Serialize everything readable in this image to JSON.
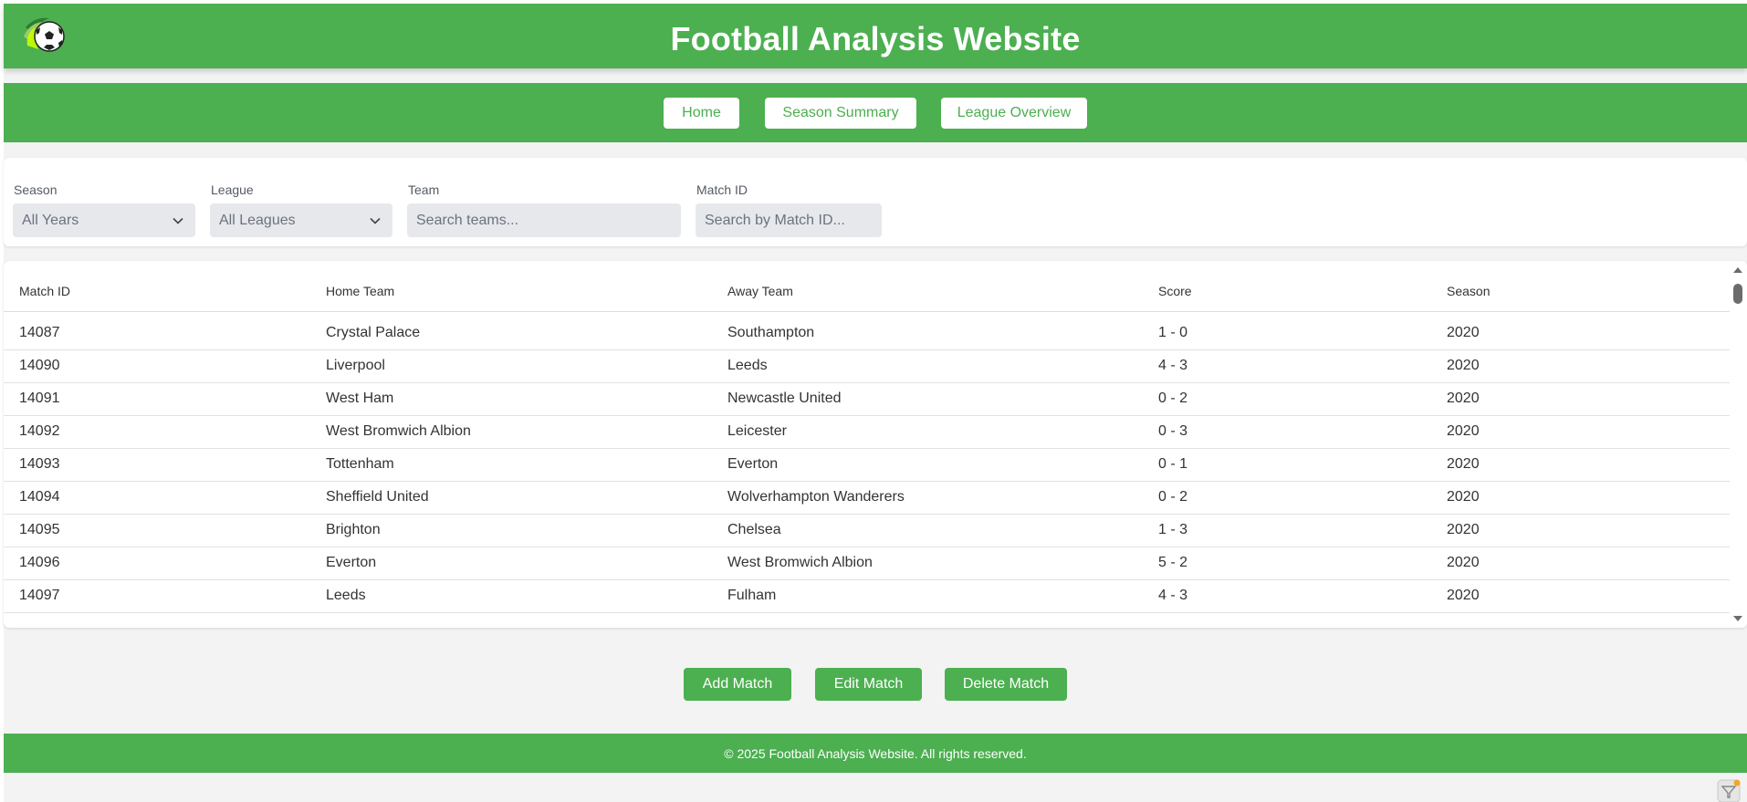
{
  "header": {
    "title": "Football Analysis Website",
    "logo_icon": "soccer-ball-icon"
  },
  "nav": {
    "items": [
      {
        "label": "Home"
      },
      {
        "label": "Season Summary"
      },
      {
        "label": "League Overview"
      }
    ]
  },
  "filters": {
    "season": {
      "label": "Season",
      "value": "All Years"
    },
    "league": {
      "label": "League",
      "value": "All Leagues"
    },
    "team": {
      "label": "Team",
      "placeholder": "Search teams..."
    },
    "match_id": {
      "label": "Match ID",
      "placeholder": "Search by Match ID..."
    }
  },
  "table": {
    "columns": [
      "Match ID",
      "Home Team",
      "Away Team",
      "Score",
      "Season"
    ],
    "rows": [
      [
        "14087",
        "Crystal Palace",
        "Southampton",
        "1 - 0",
        "2020"
      ],
      [
        "14090",
        "Liverpool",
        "Leeds",
        "4 - 3",
        "2020"
      ],
      [
        "14091",
        "West Ham",
        "Newcastle United",
        "0 - 2",
        "2020"
      ],
      [
        "14092",
        "West Bromwich Albion",
        "Leicester",
        "0 - 3",
        "2020"
      ],
      [
        "14093",
        "Tottenham",
        "Everton",
        "0 - 1",
        "2020"
      ],
      [
        "14094",
        "Sheffield United",
        "Wolverhampton Wanderers",
        "0 - 2",
        "2020"
      ],
      [
        "14095",
        "Brighton",
        "Chelsea",
        "1 - 3",
        "2020"
      ],
      [
        "14096",
        "Everton",
        "West Bromwich Albion",
        "5 - 2",
        "2020"
      ],
      [
        "14097",
        "Leeds",
        "Fulham",
        "4 - 3",
        "2020"
      ]
    ]
  },
  "actions": {
    "add": "Add Match",
    "edit": "Edit Match",
    "delete": "Delete Match"
  },
  "footer": {
    "text": "© 2025 Football Analysis Website. All rights reserved."
  },
  "colors": {
    "brand": "#4caf50",
    "background": "#f3f3f3",
    "input_bg": "#e6e8ec"
  }
}
